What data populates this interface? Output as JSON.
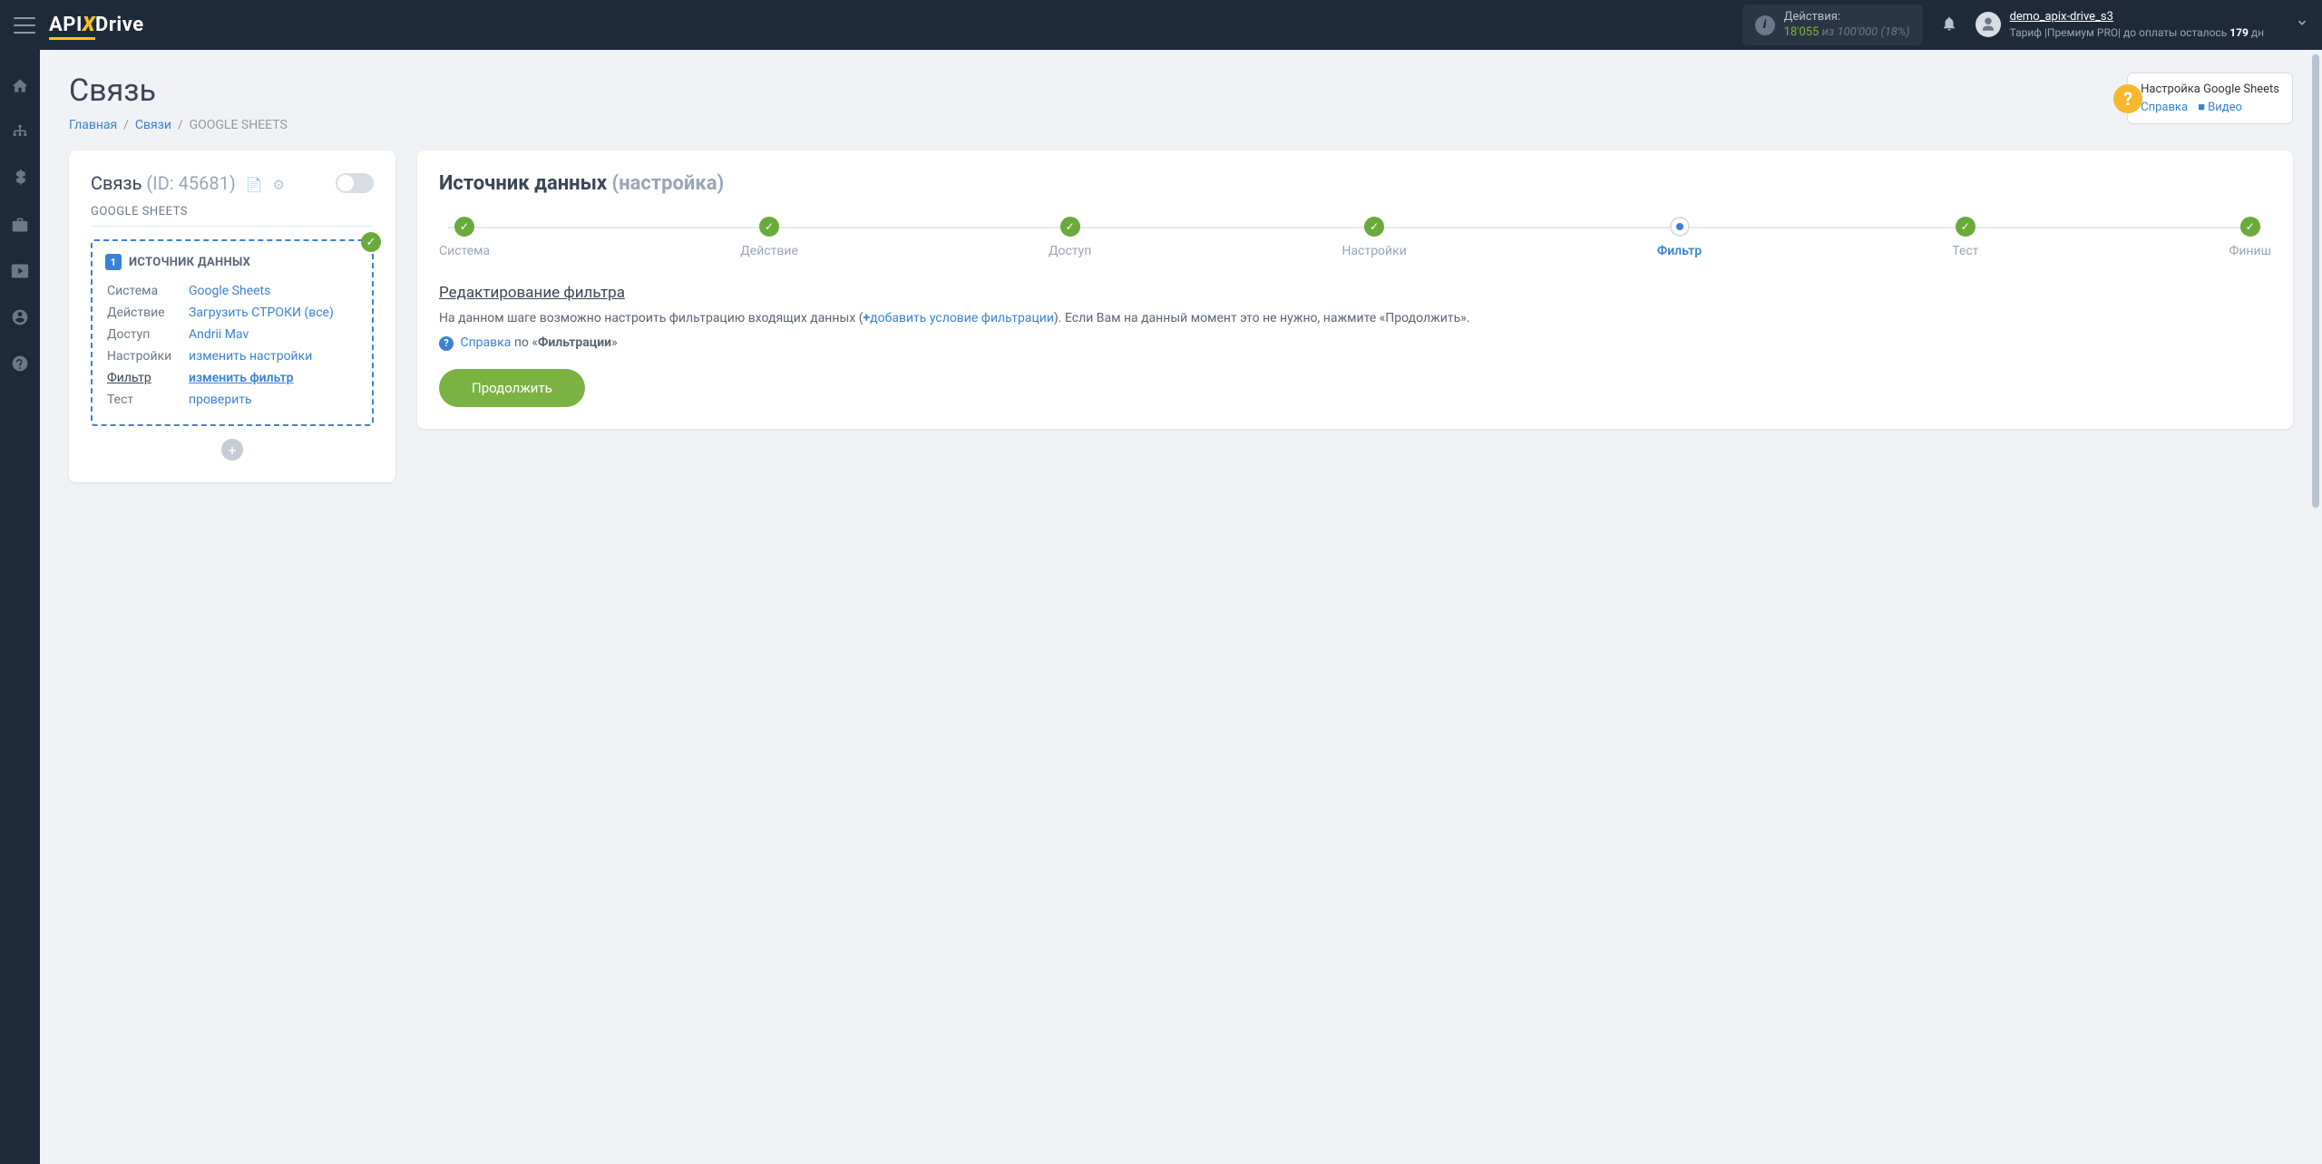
{
  "topbar": {
    "brand_pre": "API",
    "brand_post": "Drive",
    "actions_label": "Действия:",
    "actions_used": "18'055",
    "actions_of": "из",
    "actions_total": "100'000",
    "actions_pct": "(18%)",
    "user_name": "demo_apix-drive_s3",
    "tariff_pre": "Тариф |Премиум PRO| до оплаты осталось ",
    "tariff_days": "179",
    "tariff_post": " дн"
  },
  "page": {
    "title": "Связь",
    "crumb_home": "Главная",
    "crumb_conn": "Связи",
    "crumb_current": "GOOGLE SHEETS"
  },
  "help": {
    "title": "Настройка Google Sheets",
    "link_help": "Справка",
    "link_video": "Видео"
  },
  "connection": {
    "title": "Связь",
    "id": "(ID: 45681)",
    "subtitle": "GOOGLE SHEETS",
    "source_label": "ИСТОЧНИК ДАННЫХ",
    "rows": {
      "system_k": "Система",
      "system_v": "Google Sheets",
      "action_k": "Действие",
      "action_v": "Загрузить СТРОКИ (все)",
      "access_k": "Доступ",
      "access_v": "Andrii Mav",
      "settings_k": "Настройки",
      "settings_v": "изменить настройки",
      "filter_k": "Фильтр",
      "filter_v": "изменить фильтр",
      "test_k": "Тест",
      "test_v": "проверить"
    }
  },
  "right": {
    "title": "Источник данных",
    "title_sub": "(настройка)",
    "steps": {
      "s1": "Система",
      "s2": "Действие",
      "s3": "Доступ",
      "s4": "Настройки",
      "s5": "Фильтр",
      "s6": "Тест",
      "s7": "Финиш"
    },
    "filter_title": "Редактирование фильтра",
    "desc_pre": "На данном шаге возможно настроить фильтрацию входящих данных (",
    "desc_link": "добавить условие фильтрации",
    "desc_post": "). Если Вам на данный момент это не нужно, нажмите «Продолжить».",
    "help_link": "Справка",
    "help_mid": " по «",
    "help_bold": "Фильтрации",
    "help_end": "»",
    "continue": "Продолжить"
  }
}
